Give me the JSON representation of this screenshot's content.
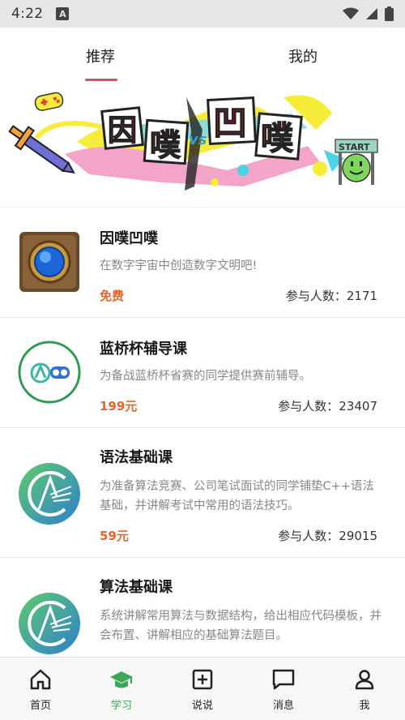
{
  "status_bar": {
    "time": "4:22",
    "notification_badge": "A",
    "icons": [
      "wifi-icon",
      "signal-icon",
      "battery-icon"
    ]
  },
  "tabs": [
    {
      "label": "推荐",
      "active": true
    },
    {
      "label": "我的",
      "active": false
    }
  ],
  "banner": {
    "title_chars": [
      "因",
      "噗",
      "凹",
      "噗"
    ],
    "vs_text": "vs",
    "start_sign": "START"
  },
  "courses": [
    {
      "title": "因噗凹噗",
      "desc": "在数字宇宙中创造数字文明吧!",
      "price": "免费",
      "participants": "参与人数：2171",
      "thumb": "gem-shield-thumb"
    },
    {
      "title": "蓝桥杯辅导课",
      "desc": "为备战蓝桥杯省赛的同学提供赛前辅导。",
      "price": "199元",
      "participants": "参与人数：23407",
      "thumb": "lanqiao-logo-thumb"
    },
    {
      "title": "语法基础课",
      "desc": "为准备算法竞赛、公司笔试面试的同学铺垫C++语法基础，并讲解考试中常用的语法技巧。",
      "price": "59元",
      "participants": "参与人数：29015",
      "thumb": "acwing-logo-thumb"
    },
    {
      "title": "算法基础课",
      "desc": "系统讲解常用算法与数据结构，给出相应代码模板，并会布置、讲解相应的基础算法题目。",
      "price": "",
      "participants": "",
      "thumb": "acwing-logo-thumb"
    }
  ],
  "bottom_nav": [
    {
      "label": "首页",
      "icon": "home-icon",
      "active": false
    },
    {
      "label": "学习",
      "icon": "graduation-cap-icon",
      "active": true
    },
    {
      "label": "说说",
      "icon": "plus-square-icon",
      "active": false
    },
    {
      "label": "消息",
      "icon": "message-icon",
      "active": false
    },
    {
      "label": "我",
      "icon": "user-icon",
      "active": false
    }
  ],
  "colors": {
    "accent_red": "#d9534f",
    "price_orange": "#e8622a",
    "active_green": "#3aa757"
  }
}
